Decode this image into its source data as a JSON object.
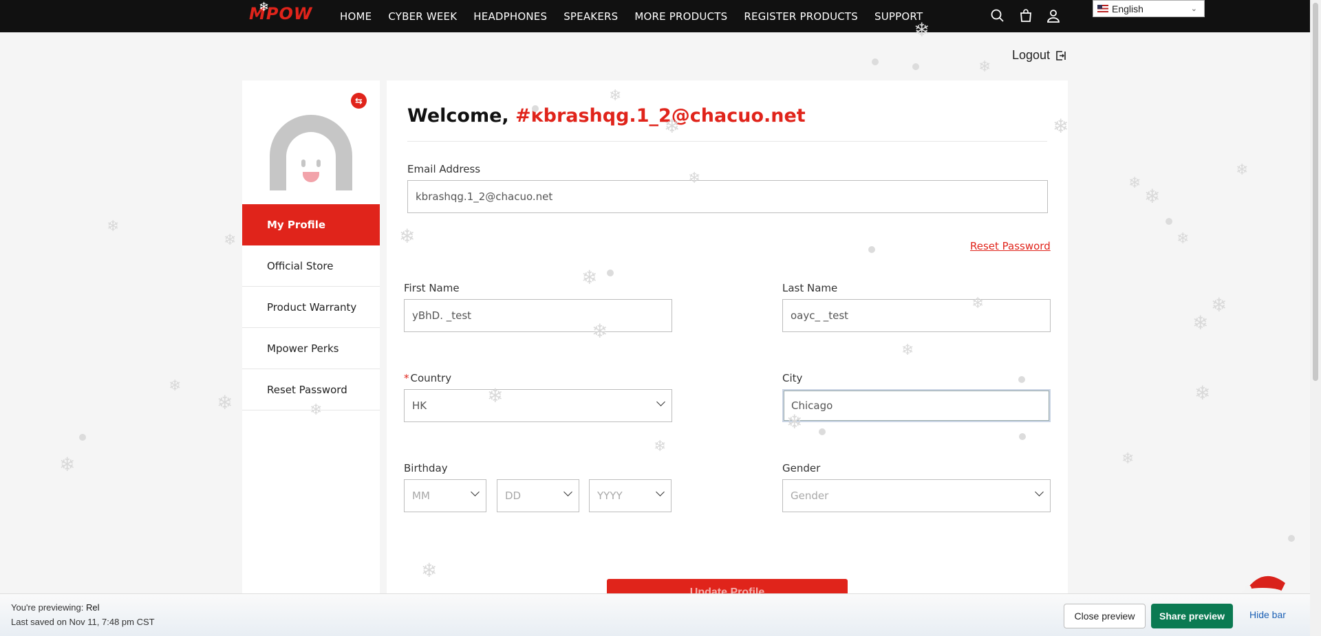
{
  "brand": {
    "logo_text": "MPOW"
  },
  "nav": {
    "items": [
      "HOME",
      "CYBER WEEK",
      "HEADPHONES",
      "SPEAKERS",
      "MORE PRODUCTS",
      "REGISTER PRODUCTS",
      "SUPPORT"
    ],
    "icons": [
      "search-icon",
      "bag-icon",
      "user-icon"
    ],
    "language": "English"
  },
  "logout_label": "Logout",
  "sidebar": {
    "items": [
      {
        "label": "My Profile",
        "active": true
      },
      {
        "label": "Official Store",
        "active": false
      },
      {
        "label": "Product Warranty",
        "active": false
      },
      {
        "label": "Mpower Perks",
        "active": false
      },
      {
        "label": "Reset Password",
        "active": false
      }
    ]
  },
  "profile": {
    "welcome_prefix": "Welcome, ",
    "welcome_name": "#kbrashqg.1_2@chacuo.net",
    "email_label": "Email Address",
    "email_value": "kbrashqg.1_2@chacuo.net",
    "reset_password_link": "Reset Password",
    "first_name_label": "First Name",
    "first_name_value": "yBhD. _test",
    "last_name_label": "Last Name",
    "last_name_value": "oayc_ _test",
    "country_label": "Country",
    "country_value": "HK",
    "city_label": "City",
    "city_value": "Chicago",
    "birthday_label": "Birthday",
    "birthday_mm": "MM",
    "birthday_dd": "DD",
    "birthday_yyyy": "YYYY",
    "gender_label": "Gender",
    "gender_placeholder": "Gender",
    "update_button": "Update Profile"
  },
  "preview_bar": {
    "previewing_prefix": "You're previewing: ",
    "previewing_name": "Rel",
    "last_saved": "Last saved on Nov 11, 7:48 pm CST",
    "close_button": "Close preview",
    "share_button": "Share preview",
    "hide_button": "Hide bar"
  },
  "colors": {
    "accent": "#e0241b",
    "nav_bg": "#111111",
    "share_green": "#0b7a52",
    "link_blue": "#1a5fb4"
  }
}
